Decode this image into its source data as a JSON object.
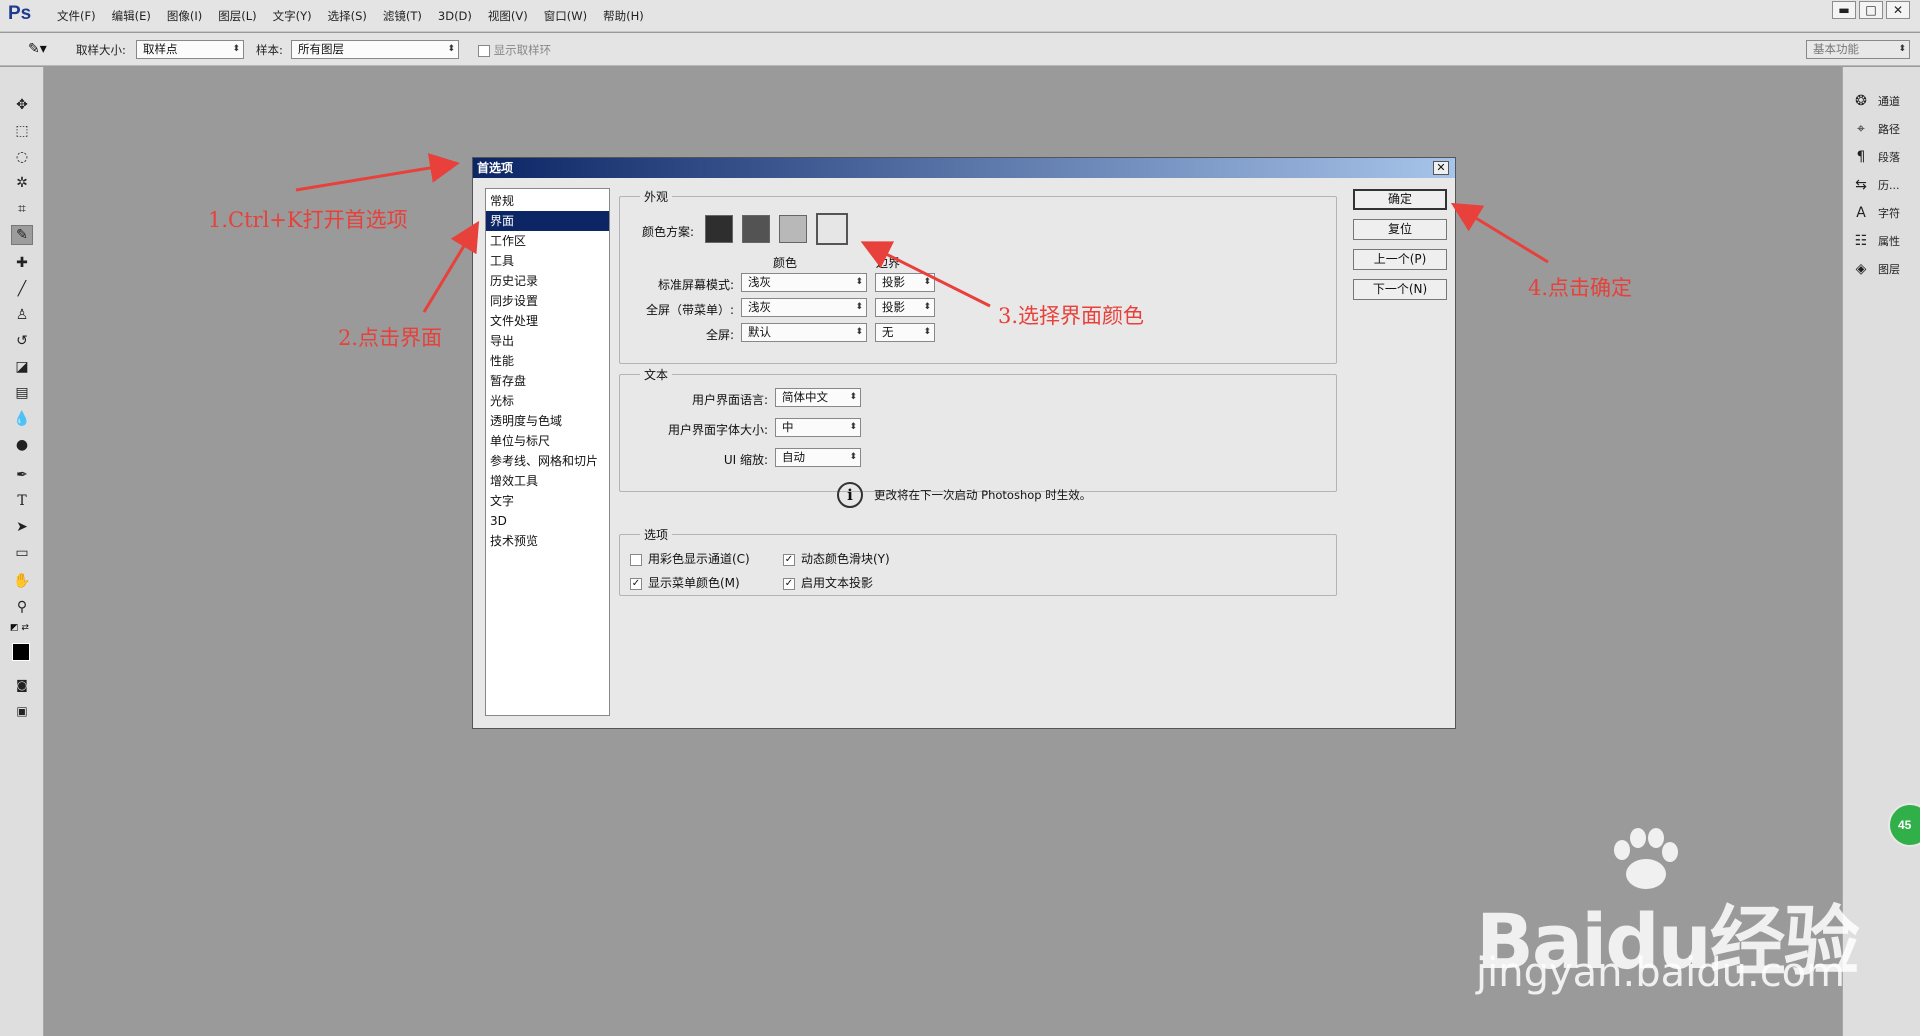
{
  "app": {
    "logo": "Ps",
    "menus": [
      "文件(F)",
      "编辑(E)",
      "图像(I)",
      "图层(L)",
      "文字(Y)",
      "选择(S)",
      "滤镜(T)",
      "3D(D)",
      "视图(V)",
      "窗口(W)",
      "帮助(H)"
    ],
    "window_controls": {
      "minimize": "▬",
      "restore": "□",
      "close": "✕"
    }
  },
  "options_bar": {
    "sample_size_label": "取样大小:",
    "sample_size_value": "取样点",
    "sample_label": "样本:",
    "sample_value": "所有图层",
    "show_ring_label": "显示取样环",
    "workspace_value": "基本功能"
  },
  "tools": [
    "move-icon",
    "marquee-icon",
    "lasso-icon",
    "quick-select-icon",
    "crop-icon",
    "eyedropper-icon",
    "healing-brush-icon",
    "brush-icon",
    "clone-stamp-icon",
    "history-brush-icon",
    "eraser-icon",
    "gradient-icon",
    "blur-icon",
    "dodge-icon",
    "pen-icon",
    "type-icon",
    "path-select-icon",
    "shape-icon",
    "hand-icon",
    "zoom-icon"
  ],
  "right_panel": {
    "items": [
      {
        "icon": "channels-icon",
        "label": "通道"
      },
      {
        "icon": "paths-icon",
        "label": "路径"
      },
      {
        "icon": "paragraph-icon",
        "label": "段落"
      },
      {
        "icon": "history-icon",
        "label": "历..."
      },
      {
        "icon": "character-icon",
        "label": "字符"
      },
      {
        "icon": "properties-icon",
        "label": "属性"
      },
      {
        "icon": "layers-icon",
        "label": "图层"
      }
    ],
    "floating_badge": "45"
  },
  "dialog": {
    "title": "首选项",
    "categories": [
      "常规",
      "界面",
      "工作区",
      "工具",
      "历史记录",
      "同步设置",
      "文件处理",
      "导出",
      "性能",
      "暂存盘",
      "光标",
      "透明度与色域",
      "单位与标尺",
      "参考线、网格和切片",
      "增效工具",
      "文字",
      "3D",
      "技术预览"
    ],
    "selected_category": "界面",
    "appearance": {
      "title": "外观",
      "color_scheme_label": "颜色方案:",
      "swatch_colors": [
        "#2e2e2e",
        "#535353",
        "#b8b8b8",
        "#e6e6e6"
      ],
      "col_color": "颜色",
      "col_border": "边界",
      "rows": [
        {
          "label": "标准屏幕模式:",
          "color": "浅灰",
          "border": "投影"
        },
        {
          "label": "全屏（带菜单）:",
          "color": "浅灰",
          "border": "投影"
        },
        {
          "label": "全屏:",
          "color": "默认",
          "border": "无"
        }
      ]
    },
    "text_group": {
      "title": "文本",
      "ui_language_label": "用户界面语言:",
      "ui_language_value": "简体中文",
      "ui_font_size_label": "用户界面字体大小:",
      "ui_font_size_value": "中",
      "ui_scale_label": "UI 缩放:",
      "ui_scale_value": "自动",
      "restart_note": "更改将在下一次启动 Photoshop 时生效。"
    },
    "options_group": {
      "title": "选项",
      "checkboxes": [
        {
          "label": "用彩色显示通道(C)",
          "checked": false
        },
        {
          "label": "动态颜色滑块(Y)",
          "checked": true
        },
        {
          "label": "显示菜单颜色(M)",
          "checked": true
        },
        {
          "label": "启用文本投影",
          "checked": true
        }
      ]
    },
    "buttons": {
      "ok": "确定",
      "reset": "复位",
      "prev": "上一个(P)",
      "next": "下一个(N)"
    }
  },
  "annotations": {
    "step1": "1.Ctrl+K打开首选项",
    "step2": "2.点击界面",
    "step3": "3.选择界面颜色",
    "step4": "4.点击确定",
    "color": "#e8403a"
  },
  "watermark": {
    "logo": "Baidu经验",
    "url": "jingyan.baidu.com"
  }
}
